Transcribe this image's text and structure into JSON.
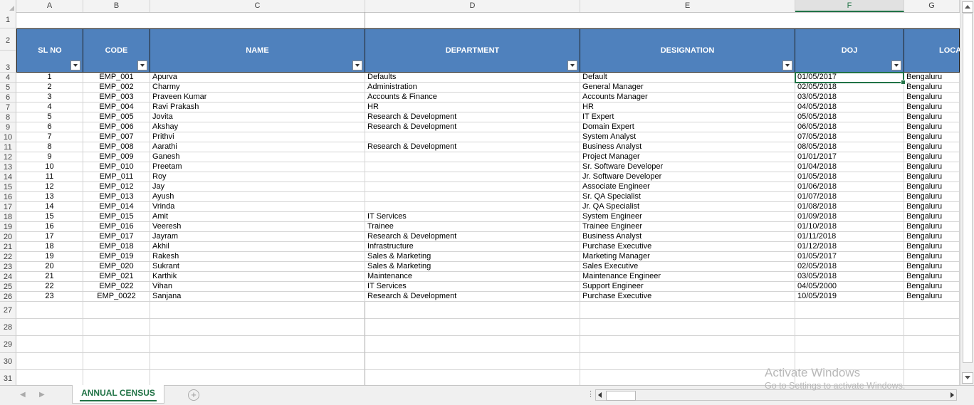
{
  "sheet": {
    "columns": [
      "A",
      "B",
      "C",
      "D",
      "E",
      "F",
      "G"
    ],
    "selected_column": "F",
    "row_numbers": [
      "1",
      "2",
      "3",
      "4",
      "5",
      "6",
      "7",
      "8",
      "9",
      "10",
      "11",
      "12",
      "13",
      "14",
      "15",
      "16",
      "17",
      "18",
      "19",
      "20",
      "21",
      "22",
      "23",
      "24",
      "25",
      "26",
      "27",
      "28",
      "29",
      "30",
      "31"
    ],
    "headers": {
      "sl_no": "SL NO",
      "code": "CODE",
      "name": "NAME",
      "department": "DEPARTMENT",
      "designation": "DESIGNATION",
      "doj": "DOJ",
      "location": "LOCA"
    },
    "rows": [
      {
        "sl": "1",
        "code": "EMP_001",
        "name": "Apurva",
        "dept": "Defaults",
        "desig": "Default",
        "doj": "01/05/2017",
        "loc": "Bengaluru"
      },
      {
        "sl": "2",
        "code": "EMP_002",
        "name": "Charmy",
        "dept": "Administration",
        "desig": "General Manager",
        "doj": "02/05/2018",
        "loc": "Bengaluru"
      },
      {
        "sl": "3",
        "code": "EMP_003",
        "name": "Praveen Kumar",
        "dept": "Accounts & Finance",
        "desig": "Accounts Manager",
        "doj": "03/05/2018",
        "loc": "Bengaluru"
      },
      {
        "sl": "4",
        "code": "EMP_004",
        "name": "Ravi Prakash",
        "dept": "HR",
        "desig": "HR",
        "doj": "04/05/2018",
        "loc": "Bengaluru"
      },
      {
        "sl": "5",
        "code": "EMP_005",
        "name": "Jovita",
        "dept": "Research & Development",
        "desig": "IT Expert",
        "doj": "05/05/2018",
        "loc": "Bengaluru"
      },
      {
        "sl": "6",
        "code": "EMP_006",
        "name": "Akshay",
        "dept": "Research & Development",
        "desig": "Domain Expert",
        "doj": "06/05/2018",
        "loc": "Bengaluru"
      },
      {
        "sl": "7",
        "code": "EMP_007",
        "name": "Prithvi",
        "dept": "",
        "desig": "System Analyst",
        "doj": "07/05/2018",
        "loc": "Bengaluru"
      },
      {
        "sl": "8",
        "code": "EMP_008",
        "name": "Aarathi",
        "dept": "Research & Development",
        "desig": "Business Analyst",
        "doj": "08/05/2018",
        "loc": "Bengaluru"
      },
      {
        "sl": "9",
        "code": "EMP_009",
        "name": "Ganesh",
        "dept": "",
        "desig": "Project Manager",
        "doj": "01/01/2017",
        "loc": "Bengaluru"
      },
      {
        "sl": "10",
        "code": "EMP_010",
        "name": "Preetam",
        "dept": "",
        "desig": "Sr. Software Developer",
        "doj": "01/04/2018",
        "loc": "Bengaluru"
      },
      {
        "sl": "11",
        "code": "EMP_011",
        "name": "Roy",
        "dept": "",
        "desig": "Jr. Software Developer",
        "doj": "01/05/2018",
        "loc": "Bengaluru"
      },
      {
        "sl": "12",
        "code": "EMP_012",
        "name": "Jay",
        "dept": "",
        "desig": "Associate Engineer",
        "doj": "01/06/2018",
        "loc": "Bengaluru"
      },
      {
        "sl": "13",
        "code": "EMP_013",
        "name": "Ayush",
        "dept": "",
        "desig": "Sr. QA Specialist",
        "doj": "01/07/2018",
        "loc": "Bengaluru"
      },
      {
        "sl": "14",
        "code": "EMP_014",
        "name": "Vrinda",
        "dept": "",
        "desig": "Jr. QA Specialist",
        "doj": "01/08/2018",
        "loc": "Bengaluru"
      },
      {
        "sl": "15",
        "code": "EMP_015",
        "name": "Amit",
        "dept": "IT Services",
        "desig": "System Engineer",
        "doj": "01/09/2018",
        "loc": "Bengaluru"
      },
      {
        "sl": "16",
        "code": "EMP_016",
        "name": "Veeresh",
        "dept": "Trainee",
        "desig": "Trainee Engineer",
        "doj": "01/10/2018",
        "loc": "Bengaluru"
      },
      {
        "sl": "17",
        "code": "EMP_017",
        "name": "Jayram",
        "dept": "Research & Development",
        "desig": "Business Analyst",
        "doj": "01/11/2018",
        "loc": "Bengaluru"
      },
      {
        "sl": "18",
        "code": "EMP_018",
        "name": "Akhil",
        "dept": "Infrastructure",
        "desig": "Purchase Executive",
        "doj": "01/12/2018",
        "loc": "Bengaluru"
      },
      {
        "sl": "19",
        "code": "EMP_019",
        "name": "Rakesh",
        "dept": "Sales & Marketing",
        "desig": "Marketing Manager",
        "doj": "01/05/2017",
        "loc": "Bengaluru"
      },
      {
        "sl": "20",
        "code": "EMP_020",
        "name": "Sukrant",
        "dept": "Sales & Marketing",
        "desig": "Sales Executive",
        "doj": "02/05/2018",
        "loc": "Bengaluru"
      },
      {
        "sl": "21",
        "code": "EMP_021",
        "name": "Karthik",
        "dept": "Maintenance",
        "desig": "Maintenance Engineer",
        "doj": "03/05/2018",
        "loc": "Bengaluru"
      },
      {
        "sl": "22",
        "code": "EMP_022",
        "name": "Vihan",
        "dept": "IT Services",
        "desig": "Support Engineer",
        "doj": "04/05/2000",
        "loc": "Bengaluru"
      },
      {
        "sl": "23",
        "code": "EMP_0022",
        "name": "Sanjana",
        "dept": "Research & Development",
        "desig": "Purchase Executive",
        "doj": "10/05/2019",
        "loc": "Bengaluru"
      }
    ]
  },
  "tabs": {
    "active_sheet": "ANNUAL CENSUS",
    "add_sheet": "+"
  },
  "watermark": {
    "line1": "Activate Windows",
    "line2": "Go to Settings to activate Windows."
  },
  "colors": {
    "header_fill": "#4f81bd",
    "accent": "#217346"
  }
}
